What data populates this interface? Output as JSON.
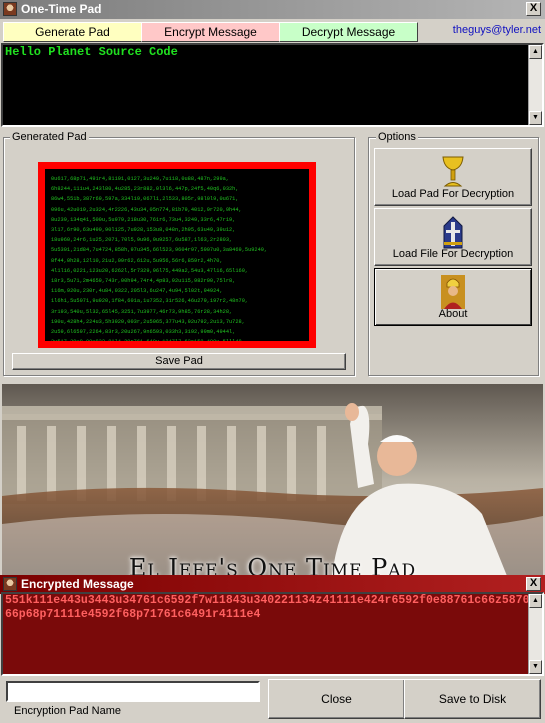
{
  "window": {
    "title": "One-Time Pad",
    "close_glyph": "X"
  },
  "tabs": [
    {
      "label": "Generate Pad",
      "color": "#ffffc0"
    },
    {
      "label": "Encrypt Message",
      "color": "#ffc8c8"
    },
    {
      "label": "Decrypt Message",
      "color": "#c8ffc8"
    }
  ],
  "email": "theguys@tyler.net",
  "message": {
    "text": "Hello Planet Source Code"
  },
  "generated_pad": {
    "group_label": "Generated Pad",
    "lines": [
      "0u617,68p71,491r4,81191,0127,3u249,7u118,0u88,487n,299a,",
      "6h8244,111u4,243l80,4u285,23r882,0l3l6,447p,24f5,40q6,032h,",
      "86w4,551b,387r69,597a,334l19,067l1,2l533,805r,98l0l9,0u671,",
      "096u,42u019,2u324,4r2226,43u34,05n774,81b79,4012,9r720,9h44,",
      "8u239,134q41,500u,5u979,218u30,761r6,73u4,3249,33r6,47r19,",
      "3l17,6r90,63u490,90l125,7u928,153u8,048n,2h95,63u49,39u12,",
      "18u960,24r6,1u25,2071,70l5,9u96,0u9257,6u587,1l63,2r2803,",
      "5u5301,21d84,7u4724,858h,97u345,66l523,9604r97,5907u0,3a8469,5u9249,",
      "8f44,0h28,12l10,21u2,09r62,612u,5u956,56r6,859r2,4h70,",
      "4l1l16,0221,123u20,6262l,5r7329,96l75,449a2,54u3,47l16,65l160,",
      "18r3,5u71,2m4659,743r,00h94,74r4,4p83,92u115,982r00,75lr8,",
      "116m,920u,230r,4u84,0322,205l3,6u247,4u94,5l02t,94924,",
      "1l6h1,5u5071,9u920,1f84,601a,1u7352,31r526,46u279,197r2,48n70,",
      "3r193,540u,5l32,65l45,3251,7u3977,46r73,9h85,76r28,34h28,",
      "190u,428h4,224u3,5h3920,003r,2u5065,377u43,92u792,2u13,7u728,",
      "2u59,6l6597,2264,83r3,20u267,9n6593,033h3,3192,99m0,4944l,",
      "3u517,39u9,00u832,81l4,20r761,640u,1247l7,62r159,499u,5lll48,",
      "6u8509,6m24,60u53,32u725,9u524,559r,15,102n0,245h5,1u363,805u,",
      "17u18,2u37,5l9117,8u9,497r,0u4h3,7l584,99l192,146u78,6n453,",
      "3u4124,4ll050,732u07,727u18,5u5734,6m445,589u2,2u254,746r31,3u4921,"
    ],
    "save_label": "Save Pad"
  },
  "options": {
    "group_label": "Options",
    "buttons": [
      {
        "label": "Load Pad For Decryption",
        "icon": "golden-chalice-icon"
      },
      {
        "label": "Load File For Decryption",
        "icon": "bishop-mitre-icon"
      },
      {
        "label": "About",
        "icon": "pope-portrait-icon"
      }
    ]
  },
  "banner": {
    "title": "El Jefe's One Time Pad"
  },
  "encrypted": {
    "title": "Encrypted Message",
    "close_glyph": "X",
    "text": "551k111e443u3443u34761c6592f7w11843u340221134z41111e424r6592f0e88761c66z587066p68p71111e4592f68p71761c6491r4111e4",
    "pad_name_label": "Encryption Pad Name",
    "pad_name_value": "",
    "close_label": "Close",
    "save_label": "Save to Disk"
  },
  "colors": {
    "editor_text": "#20e020",
    "pad_border": "#ff0000",
    "encrypted_bg": "#7a0a0a",
    "encrypted_text": "#ff6060"
  }
}
